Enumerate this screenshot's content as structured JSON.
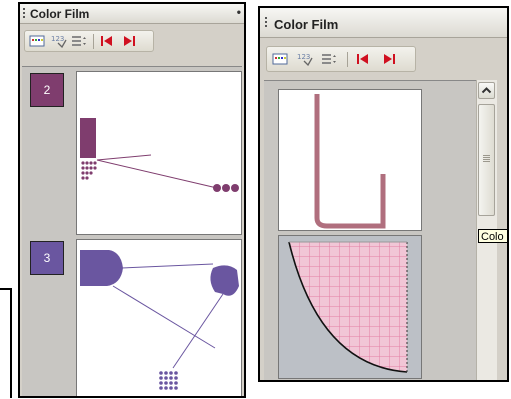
{
  "left_panel": {
    "title": "Color Film",
    "pin_glyph": "•",
    "toolbar": [
      {
        "name": "thumbnail-view-icon"
      },
      {
        "name": "numbering-icon"
      },
      {
        "name": "list-options-icon"
      },
      {
        "name": "go-first-icon"
      },
      {
        "name": "go-last-icon"
      }
    ],
    "frames": [
      {
        "label": "2",
        "color": "#7f3d6e"
      },
      {
        "label": "3",
        "color": "#6a56a0"
      }
    ]
  },
  "right_panel": {
    "title": "Color Film",
    "toolbar": [
      {
        "name": "thumbnail-view-icon"
      },
      {
        "name": "numbering-icon"
      },
      {
        "name": "list-options-icon"
      },
      {
        "name": "go-first-icon"
      },
      {
        "name": "go-last-icon"
      }
    ],
    "tooltip": "Colo",
    "stroke_color": "#b06f7e",
    "grid_color": "#e27fa4"
  },
  "colors": {
    "panel_bg": "#d4d0c8",
    "sidebar_gray": "#c8c6c2",
    "nav_red": "#d01020"
  }
}
